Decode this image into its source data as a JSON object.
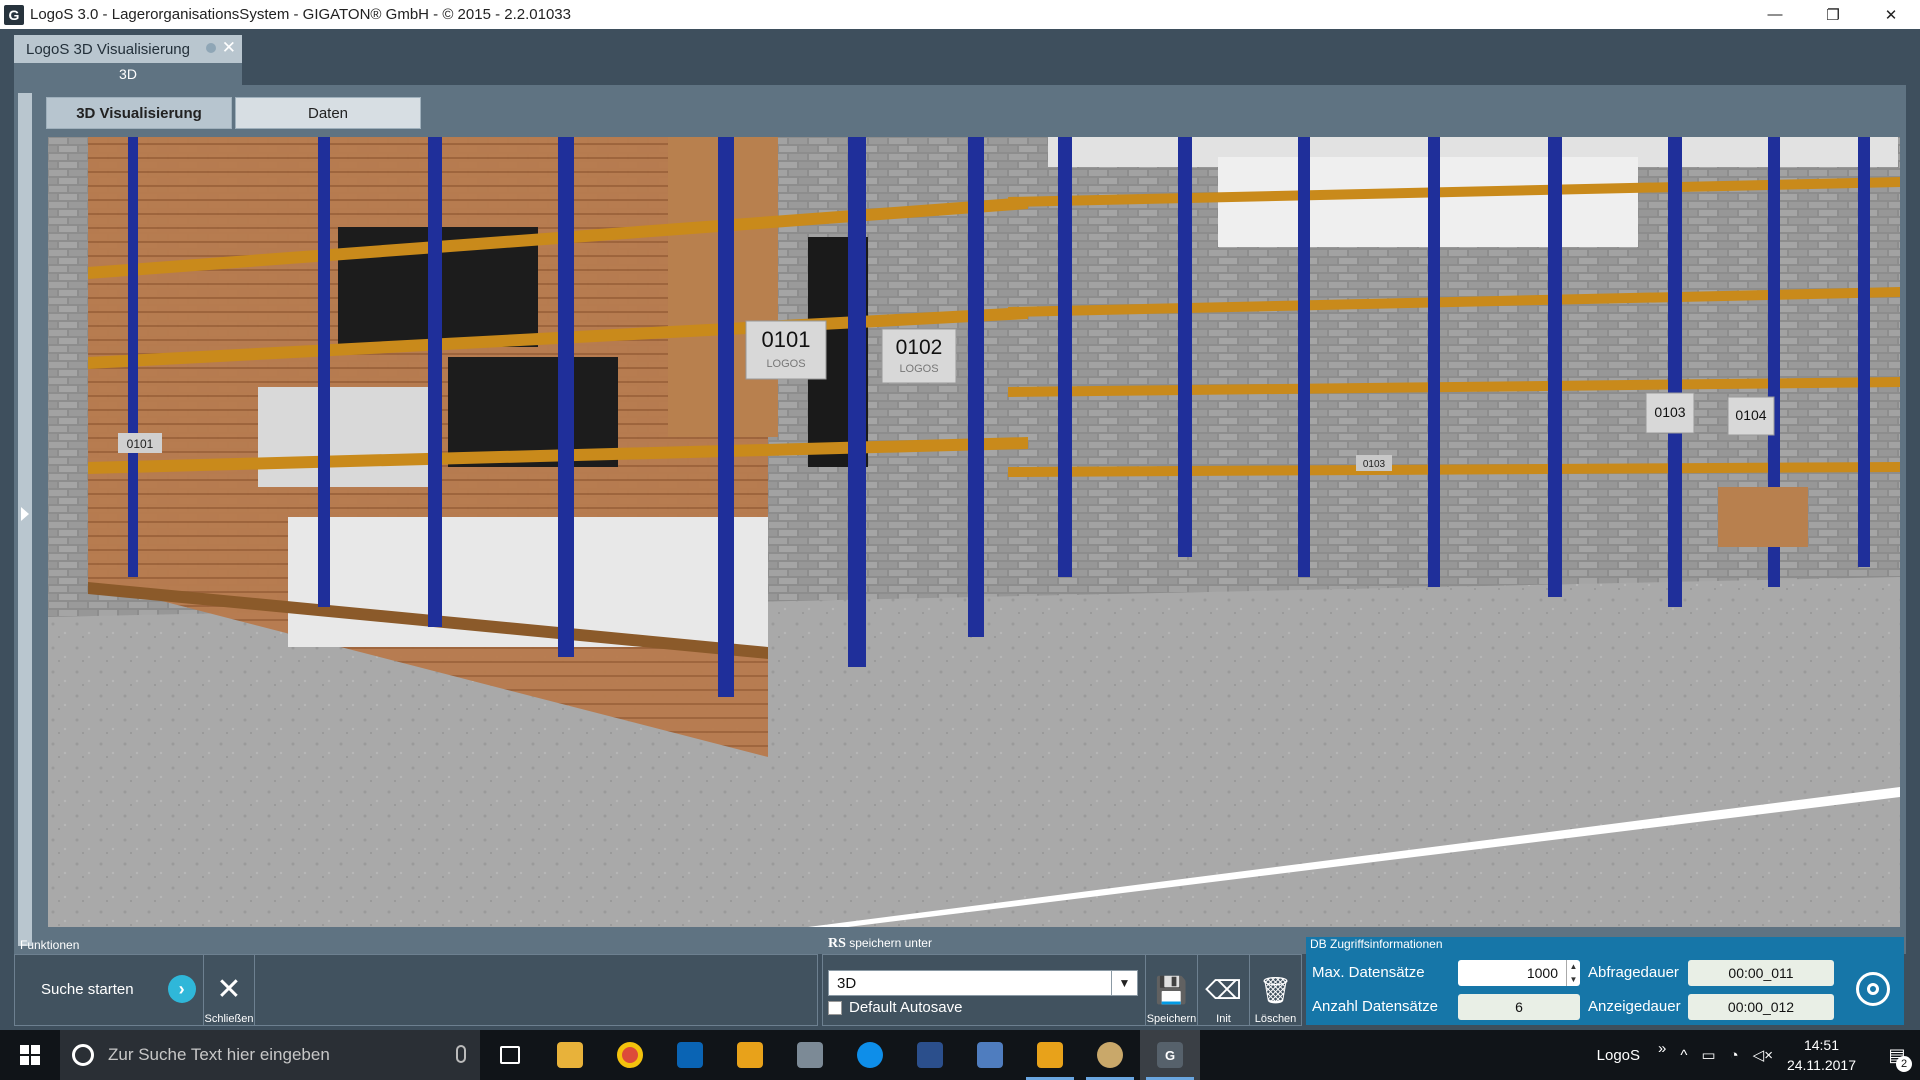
{
  "window": {
    "logo_letter": "G",
    "title": "LogoS 3.0 - LagerorganisationsSystem - GIGATON® GmbH - © 2015 - 2.2.01033",
    "minimize": "—",
    "restore": "❐",
    "close": "✕"
  },
  "document_tab": {
    "label": "LogoS 3D Visualisierung",
    "close": "✕",
    "subtab": "3D"
  },
  "view_tabs": [
    {
      "label": "3D Visualisierung"
    },
    {
      "label": "Daten"
    }
  ],
  "scene": {
    "rack_labels": [
      "0101",
      "0102",
      "0103",
      "0104"
    ],
    "small_labels": [
      "0101",
      "0103"
    ],
    "brand_tag": "LOGOS"
  },
  "funktionen": {
    "title": "Funktionen",
    "search_label": "Suche starten",
    "search_arrow": "›",
    "close_label": "Schließen",
    "close_glyph": "✕"
  },
  "speichern": {
    "title_prefix": "RS",
    "title": "speichern unter",
    "selected": "3D",
    "drop_arrow": "▼",
    "autosave_label": "Default Autosave",
    "buttons": [
      {
        "label": "Speichern",
        "glyph": "💾"
      },
      {
        "label": "Init",
        "glyph": "⌫"
      },
      {
        "label": "Löschen",
        "glyph": "🗑"
      }
    ]
  },
  "db": {
    "title": "DB Zugriffsinformationen",
    "max_label": "Max. Datensätze",
    "max_value": "1000",
    "count_label": "Anzahl Datensätze",
    "count_value": "6",
    "query_label": "Abfragedauer",
    "query_value": "00:00_011",
    "display_label": "Anzeigedauer",
    "display_value": "00:00_012"
  },
  "taskbar": {
    "search_placeholder": "Zur Suche Text hier eingeben",
    "tray_app": "LogoS",
    "tray_chevron": "»",
    "time": "14:51",
    "date": "24.11.2017",
    "notifications": "2"
  },
  "colors": {
    "rack_blue": "#1f2f9a",
    "beam_orange": "#c98a1b",
    "db_panel": "#1676a8",
    "accent_cyan": "#2fb7d9"
  }
}
